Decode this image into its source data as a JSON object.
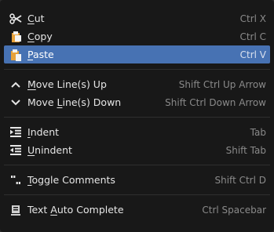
{
  "menu": {
    "items": [
      {
        "icon": "scissors-icon",
        "before": "",
        "ul": "C",
        "after": "ut",
        "shortcut": "Ctrl X"
      },
      {
        "icon": "copy-icon",
        "before": "",
        "ul": "C",
        "after": "opy",
        "shortcut": "Ctrl C"
      },
      {
        "icon": "paste-icon",
        "before": "",
        "ul": "P",
        "after": "aste",
        "shortcut": "Ctrl V"
      },
      {
        "icon": "chevron-up-icon",
        "before": "",
        "ul": "M",
        "after": "ove Line(s) Up",
        "shortcut": "Shift Ctrl Up Arrow"
      },
      {
        "icon": "chevron-down-icon",
        "before": "Move ",
        "ul": "L",
        "after": "ine(s) Down",
        "shortcut": "Shift Ctrl Down Arrow"
      },
      {
        "icon": "indent-icon",
        "before": "",
        "ul": "I",
        "after": "ndent",
        "shortcut": "Tab"
      },
      {
        "icon": "unindent-icon",
        "before": "",
        "ul": "U",
        "after": "nindent",
        "shortcut": "Shift Tab"
      },
      {
        "icon": "comment-icon",
        "before": "",
        "ul": "T",
        "after": "oggle Comments",
        "shortcut": "Shift Ctrl D"
      },
      {
        "icon": "autocomplete-icon",
        "before": "Text ",
        "ul": "A",
        "after": "uto Complete",
        "shortcut": "Ctrl Spacebar"
      }
    ]
  },
  "colors": {
    "highlight": "#4772b3",
    "background": "#181818"
  }
}
